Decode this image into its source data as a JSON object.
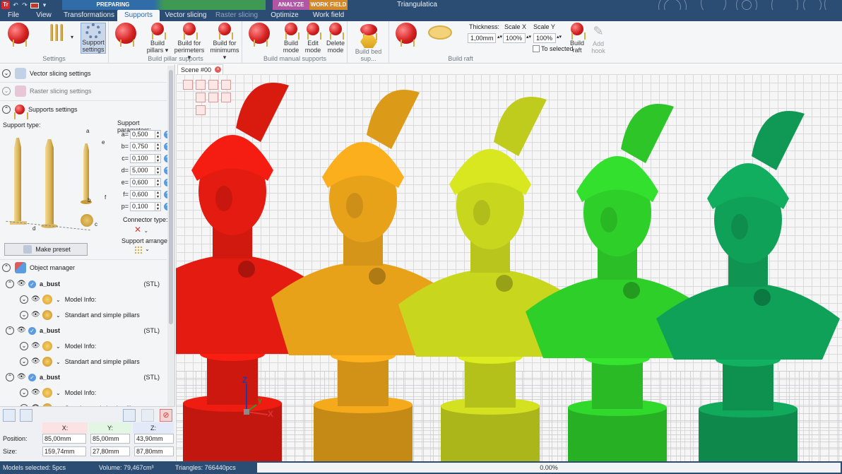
{
  "app": {
    "title": "Triangulatica",
    "logo": "Tr"
  },
  "context_groups": {
    "preparing": "PREPARING",
    "analyze": "ANALYZE",
    "work_field": "WORK FIELD"
  },
  "tabs": [
    {
      "label": "File"
    },
    {
      "label": "View"
    },
    {
      "label": "Transformations"
    },
    {
      "label": "Supports"
    },
    {
      "label": "Vector slicing"
    },
    {
      "label": "Raster slicing"
    },
    {
      "label": "Optimize"
    },
    {
      "label": "Work field"
    }
  ],
  "ribbon": {
    "groups": {
      "settings": "Settings",
      "build_pillar": "Build pillar supports",
      "build_manual": "Build manual supports",
      "build_bed": "Build bed sup...",
      "build_raft": "Build raft"
    },
    "buttons": {
      "support_settings": "Support settings",
      "build_pillars": "Build pillars ▾",
      "build_perimeters": "Build for perimeters ▾",
      "build_minimums": "Build for minimums ▾",
      "build_mode": "Build mode",
      "edit_mode": "Edit mode",
      "delete_mode": "Delete mode",
      "build_raft": "Build raft",
      "add_hook": "Add hook"
    },
    "raft": {
      "thickness_label": "Thickness:",
      "thickness_value": "1,00mm",
      "scale_x_label": "Scale X",
      "scale_x_value": "100%",
      "scale_y_label": "Scale Y",
      "scale_y_value": "100%",
      "to_selected_label": "To selected"
    }
  },
  "left_panel": {
    "sections": {
      "vector": "Vector slicing settings",
      "raster": "Raster slicing settings",
      "supports": "Supports settings",
      "object_manager": "Object manager"
    },
    "support_type_label": "Support type:",
    "support_params_label": "Support parameters:",
    "params": [
      {
        "label": "a=",
        "value": "0,500"
      },
      {
        "label": "b=",
        "value": "0,750"
      },
      {
        "label": "c=",
        "value": "0,100"
      },
      {
        "label": "d=",
        "value": "5,000"
      },
      {
        "label": "e=",
        "value": "0,600"
      },
      {
        "label": "f=",
        "value": "0,600"
      },
      {
        "label": "p=",
        "value": "0,100"
      }
    ],
    "diagram_letters": {
      "a": "a",
      "b": "b",
      "c": "c",
      "d": "d",
      "e": "e",
      "f": "f"
    },
    "connector_type_label": "Connector type:",
    "support_arrange_label": "Support arrange:",
    "make_preset_label": "Make preset",
    "objects": [
      {
        "name": "a_bust",
        "type": "(STL)",
        "children": [
          "Model Info:",
          "Standart and simple pillars"
        ]
      },
      {
        "name": "a_bust",
        "type": "(STL)",
        "children": [
          "Model Info:",
          "Standart and simple pillars"
        ]
      },
      {
        "name": "a_bust",
        "type": "(STL)",
        "children": [
          "Model Info:",
          "Standart and simple pillars"
        ]
      }
    ]
  },
  "transform": {
    "x_label": "X:",
    "y_label": "Y:",
    "z_label": "Z:",
    "position_label": "Position:",
    "size_label": "Size:",
    "position": {
      "x": "85,00mm",
      "y": "85,00mm",
      "z": "43,90mm"
    },
    "size": {
      "x": "159,74mm",
      "y": "27,80mm",
      "z": "87,80mm"
    }
  },
  "viewport": {
    "scene_tab": "Scene #00",
    "axis": {
      "x": "X",
      "y": "Y",
      "z": "Z"
    },
    "bust_colors": [
      "#e31b10",
      "#e8a21a",
      "#c9d61e",
      "#2fcf2a",
      "#10a158"
    ]
  },
  "status": {
    "models_selected": "Models selected: 5pcs",
    "volume": "Volume: 79,467cm³",
    "triangles": "Triangles: 766440pcs",
    "progress": "0.00%"
  },
  "colors": {
    "titlebar": "#2b4d73",
    "accent": "#2a66b5"
  }
}
